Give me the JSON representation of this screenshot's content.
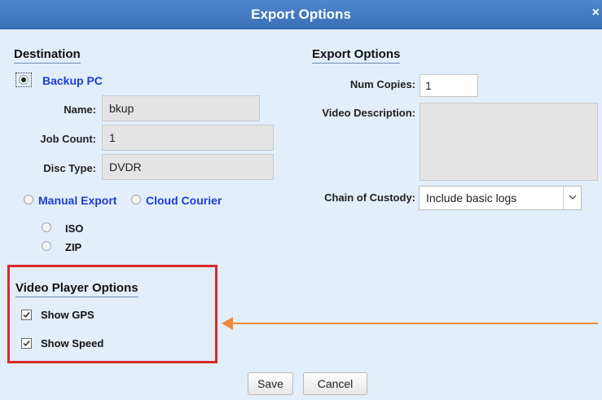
{
  "dialog": {
    "title": "Export Options",
    "close_glyph": "×"
  },
  "destination": {
    "heading": "Destination",
    "backup_pc_label": "Backup PC",
    "name_label": "Name:",
    "name_value": "bkup",
    "job_count_label": "Job Count:",
    "job_count_value": "1",
    "disc_type_label": "Disc Type:",
    "disc_type_value": "DVDR",
    "manual_export_label": "Manual Export",
    "cloud_courier_label": "Cloud Courier",
    "iso_label": "ISO",
    "zip_label": "ZIP",
    "selected": "Backup PC"
  },
  "export_options": {
    "heading": "Export Options",
    "num_copies_label": "Num Copies:",
    "num_copies_value": "1",
    "video_description_label": "Video Description:",
    "video_description_value": "",
    "chain_of_custody_label": "Chain of Custody:",
    "chain_of_custody_value": "Include basic logs",
    "dropdown_icon": "chevron-down-icon"
  },
  "video_player_options": {
    "heading": "Video Player Options",
    "show_gps_label": "Show GPS",
    "show_gps_checked": true,
    "show_speed_label": "Show Speed",
    "show_speed_checked": true
  },
  "buttons": {
    "save": "Save",
    "cancel": "Cancel"
  },
  "colors": {
    "title_bar": "#3a70b8",
    "background": "#e3eefb",
    "highlight": "#d92b2b",
    "arrow": "#ef8a3d",
    "link": "#1c3dd4"
  }
}
